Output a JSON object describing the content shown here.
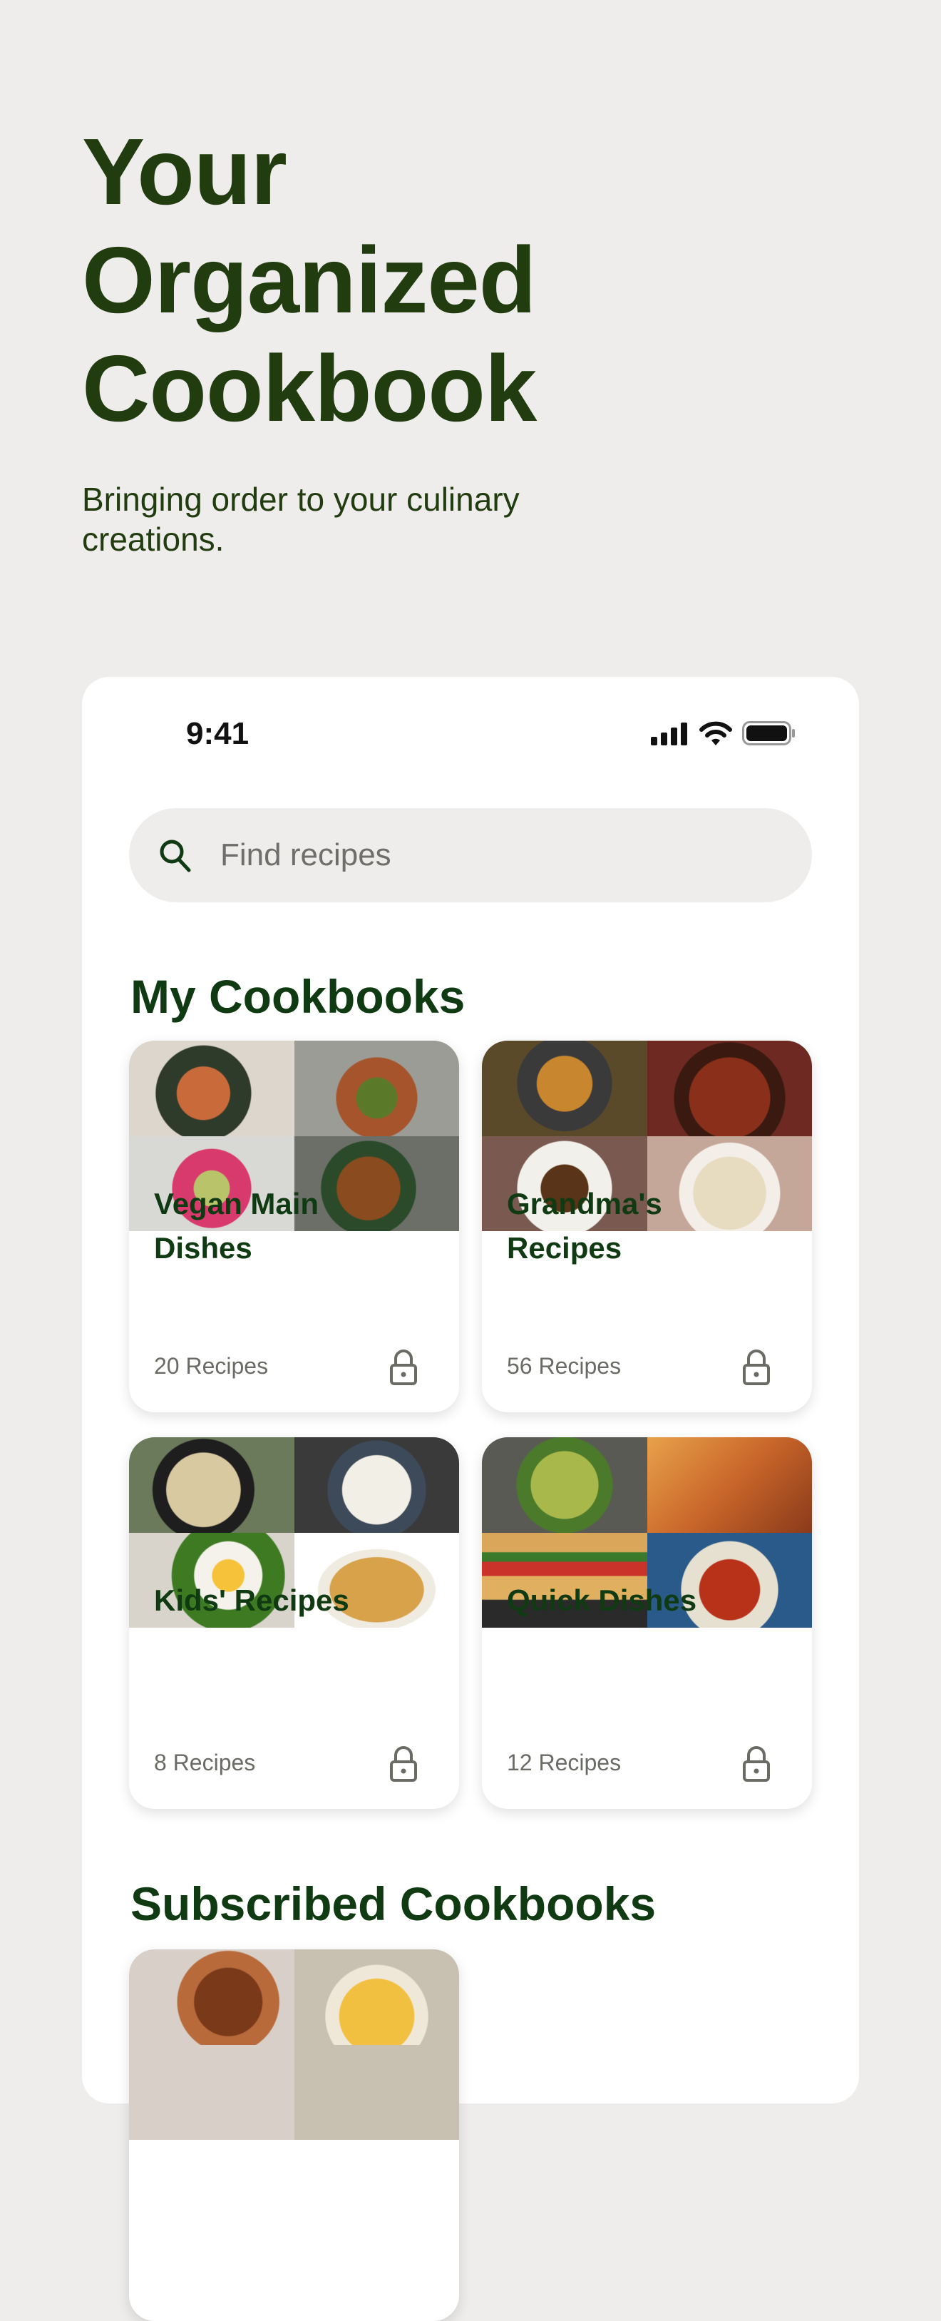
{
  "hero": {
    "title": "Your Organized Cookbook",
    "subtitle": "Bringing order to your culinary creations."
  },
  "status_bar": {
    "time": "9:41"
  },
  "search": {
    "placeholder": "Find recipes"
  },
  "sections": {
    "my_cookbooks": "My Cookbooks",
    "subscribed": "Subscribed Cookbooks"
  },
  "cookbooks": [
    {
      "title": "Vegan Main Dishes",
      "count": "20 Recipes",
      "icon": "lock-icon"
    },
    {
      "title": "Grandma's Recipes",
      "count": "56 Recipes",
      "icon": "lock-icon"
    },
    {
      "title": "Kids' Recipes",
      "count": "8 Recipes",
      "icon": "lock-icon"
    },
    {
      "title": "Quick Dishes",
      "count": "12 Recipes",
      "icon": "lock-icon"
    }
  ],
  "colors": {
    "brand_dark_green": "#0f3a12",
    "background": "#eeedeb"
  }
}
